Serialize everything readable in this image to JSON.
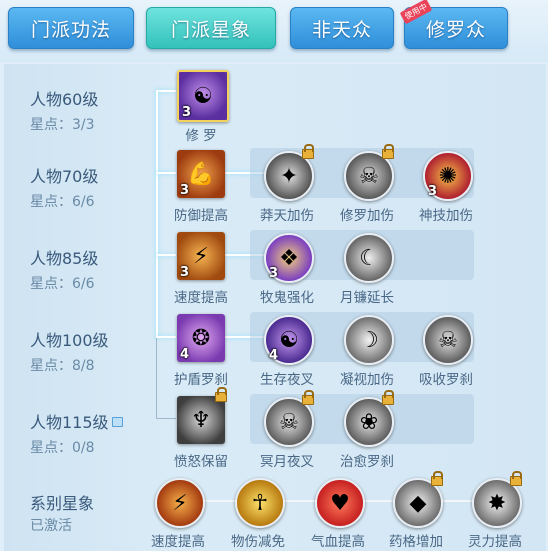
{
  "tabs": [
    {
      "label": "门派功法",
      "active": false
    },
    {
      "label": "门派星象",
      "active": true
    },
    {
      "label": "非天众",
      "active": false
    },
    {
      "label": "修罗众",
      "active": false,
      "badge": "使用中"
    }
  ],
  "levels": [
    {
      "title": "人物60级",
      "stars": "星点：3/3",
      "locked": false
    },
    {
      "title": "人物70级",
      "stars": "星点：6/6",
      "locked": false
    },
    {
      "title": "人物85级",
      "stars": "星点：6/6",
      "locked": false
    },
    {
      "title": "人物100级",
      "stars": "星点：8/8",
      "locked": false
    },
    {
      "title": "人物115级",
      "stars": "星点：0/8",
      "locked": true
    }
  ],
  "nodes": {
    "r0_main": {
      "label": "修 罗",
      "count": "3"
    },
    "r1_main": {
      "label": "防御提高",
      "count": "3"
    },
    "r1_a": {
      "label": "莽天加伤",
      "count": ""
    },
    "r1_b": {
      "label": "修罗加伤",
      "count": ""
    },
    "r1_c": {
      "label": "神技加伤",
      "count": "3"
    },
    "r2_main": {
      "label": "速度提高",
      "count": "3"
    },
    "r2_a": {
      "label": "牧鬼强化",
      "count": "3"
    },
    "r2_b": {
      "label": "月镰延长",
      "count": ""
    },
    "r3_main": {
      "label": "护盾罗刹",
      "count": "4"
    },
    "r3_a": {
      "label": "生存夜叉",
      "count": "4"
    },
    "r3_b": {
      "label": "凝视加伤",
      "count": ""
    },
    "r3_c": {
      "label": "吸收罗刹",
      "count": ""
    },
    "r4_main": {
      "label": "愤怒保留",
      "count": ""
    },
    "r4_a": {
      "label": "冥月夜叉",
      "count": ""
    },
    "r4_b": {
      "label": "治愈罗刹",
      "count": ""
    }
  },
  "constellation": {
    "title": "系别星象",
    "status": "已激活",
    "items": [
      {
        "label": "速度提高"
      },
      {
        "label": "物伤减免"
      },
      {
        "label": "气血提高"
      },
      {
        "label": "药格增加"
      },
      {
        "label": "灵力提高"
      }
    ]
  },
  "colors": {
    "tab_blue": "#3a9be0",
    "tab_active": "#3fc9c2",
    "text": "#4a6886"
  }
}
